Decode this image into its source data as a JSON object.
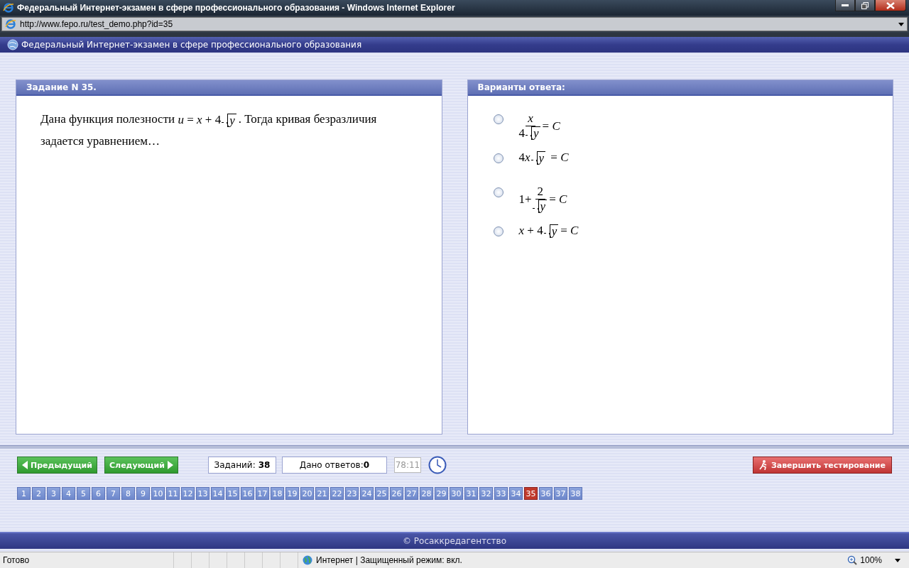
{
  "window": {
    "title": "Федеральный Интернет-экзамен в сфере профессионального образования - Windows Internet Explorer"
  },
  "address_bar": {
    "url": "http://www.fepo.ru/test_demo.php?id=35"
  },
  "site_header": {
    "title": "Федеральный Интернет-экзамен в сфере профессионального образования"
  },
  "question_panel": {
    "title": "Задание N 35.",
    "text_before": "Дана функция полезности",
    "formula": [
      {
        "kind": "text",
        "s": "*u* = *x* + 4"
      },
      {
        "kind": "sqrt",
        "s": "*y*"
      }
    ],
    "text_after": ". Тогда кривая безразличия задается уравнением…"
  },
  "answers_panel": {
    "title": "Варианты ответа:",
    "options": [
      {
        "selected": false,
        "formula": [
          {
            "kind": "frac",
            "num": [
              {
                "kind": "text",
                "s": "*x*"
              }
            ],
            "den": [
              {
                "kind": "text",
                "s": "4"
              },
              {
                "kind": "sqrt",
                "s": "*y*"
              }
            ]
          },
          {
            "kind": "text",
            "s": "= *C*"
          }
        ]
      },
      {
        "selected": false,
        "formula": [
          {
            "kind": "text",
            "s": "4"
          },
          {
            "kind": "text",
            "s": "*x*"
          },
          {
            "kind": "sqrt",
            "s": "*y*"
          },
          {
            "kind": "text",
            "s": " = *C*"
          }
        ]
      },
      {
        "selected": false,
        "formula": [
          {
            "kind": "text",
            "s": "1+"
          },
          {
            "kind": "frac",
            "num": [
              {
                "kind": "text",
                "s": "2"
              }
            ],
            "den": [
              {
                "kind": "sqrt",
                "s": "*y*"
              }
            ]
          },
          {
            "kind": "text",
            "s": "= *C*"
          }
        ]
      },
      {
        "selected": false,
        "formula": [
          {
            "kind": "text",
            "s": "*x* + 4"
          },
          {
            "kind": "sqrt",
            "s": "*y*"
          },
          {
            "kind": "text",
            "s": "= *C*"
          }
        ]
      }
    ]
  },
  "navigation": {
    "prev": "Предыдущий",
    "next": "Следующий",
    "tasks": {
      "label": "Заданий:",
      "value": "38"
    },
    "answered": {
      "label": "Дано ответов:",
      "value": "0"
    },
    "timer": "78:11",
    "finish": "Завершить тестирование"
  },
  "pages": [
    {
      "label": "1",
      "selected": false
    },
    {
      "label": "2",
      "selected": false
    },
    {
      "label": "3",
      "selected": false
    },
    {
      "label": "4",
      "selected": false
    },
    {
      "label": "5",
      "selected": false
    },
    {
      "label": "6",
      "selected": false
    },
    {
      "label": "7",
      "selected": false
    },
    {
      "label": "8",
      "selected": false
    },
    {
      "label": "9",
      "selected": false
    },
    {
      "label": "10",
      "selected": false
    },
    {
      "label": "11",
      "selected": false
    },
    {
      "label": "12",
      "selected": false
    },
    {
      "label": "13",
      "selected": false
    },
    {
      "label": "14",
      "selected": false
    },
    {
      "label": "15",
      "selected": false
    },
    {
      "label": "16",
      "selected": false
    },
    {
      "label": "17",
      "selected": false
    },
    {
      "label": "18",
      "selected": false
    },
    {
      "label": "19",
      "selected": false
    },
    {
      "label": "20",
      "selected": false
    },
    {
      "label": "21",
      "selected": false
    },
    {
      "label": "22",
      "selected": false
    },
    {
      "label": "23",
      "selected": false
    },
    {
      "label": "24",
      "selected": false
    },
    {
      "label": "25",
      "selected": false
    },
    {
      "label": "26",
      "selected": false
    },
    {
      "label": "27",
      "selected": false
    },
    {
      "label": "28",
      "selected": false
    },
    {
      "label": "29",
      "selected": false
    },
    {
      "label": "30",
      "selected": false
    },
    {
      "label": "31",
      "selected": false
    },
    {
      "label": "32",
      "selected": false
    },
    {
      "label": "33",
      "selected": false
    },
    {
      "label": "34",
      "selected": false
    },
    {
      "label": "35",
      "selected": true
    },
    {
      "label": "36",
      "selected": false
    },
    {
      "label": "37",
      "selected": false
    },
    {
      "label": "38",
      "selected": false
    }
  ],
  "footer": {
    "text": "© Росаккредагентство"
  },
  "status_bar": {
    "status": "Готово",
    "zone": "Интернет | Защищенный режим: вкл.",
    "zoom": "100%"
  }
}
